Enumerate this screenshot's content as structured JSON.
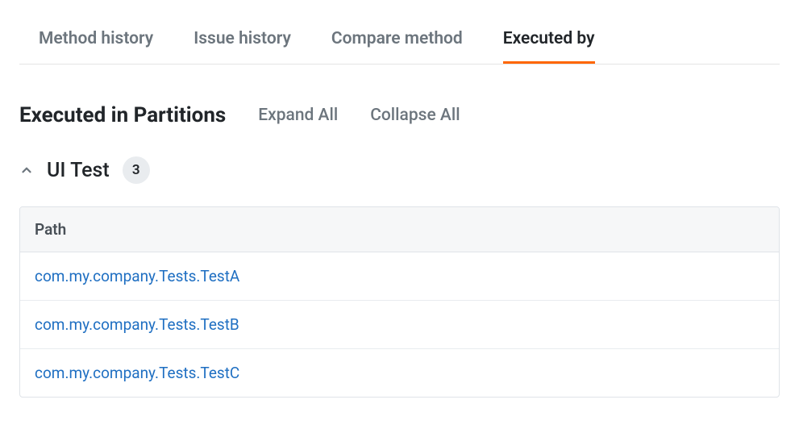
{
  "tabs": [
    {
      "label": "Method history",
      "active": false
    },
    {
      "label": "Issue history",
      "active": false
    },
    {
      "label": "Compare method",
      "active": false
    },
    {
      "label": "Executed by",
      "active": true
    }
  ],
  "section": {
    "title": "Executed in Partitions",
    "expand_label": "Expand All",
    "collapse_label": "Collapse All"
  },
  "partition": {
    "name": "UI Test",
    "count": "3",
    "column_header": "Path",
    "rows": [
      "com.my.company.Tests.TestA",
      "com.my.company.Tests.TestB",
      "com.my.company.Tests.TestC"
    ]
  }
}
